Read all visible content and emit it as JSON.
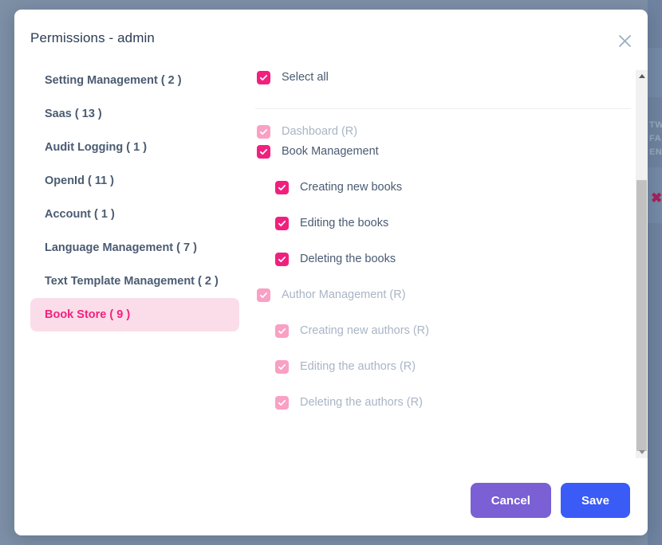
{
  "modal": {
    "title": "Permissions - admin",
    "close_icon": "close-icon"
  },
  "groups": [
    {
      "label": "Setting Management ( 2 )",
      "active": false
    },
    {
      "label": "Saas ( 13 )",
      "active": false
    },
    {
      "label": "Audit Logging ( 1 )",
      "active": false
    },
    {
      "label": "OpenId ( 11 )",
      "active": false
    },
    {
      "label": "Account ( 1 )",
      "active": false
    },
    {
      "label": "Language Management ( 7 )",
      "active": false
    },
    {
      "label": "Text Template Management ( 2 )",
      "active": false
    },
    {
      "label": "Book Store ( 9 )",
      "active": true
    }
  ],
  "select_all": {
    "label": "Select all",
    "checked": true,
    "disabled": false
  },
  "permissions": [
    {
      "label": "Dashboard (R)",
      "level": 0,
      "checked": true,
      "disabled": true,
      "spacing": "none"
    },
    {
      "label": "Book Management",
      "level": 0,
      "checked": true,
      "disabled": false,
      "spacing": "tight"
    },
    {
      "label": "Creating new books",
      "level": 1,
      "checked": true,
      "disabled": false,
      "spacing": "gap"
    },
    {
      "label": "Editing the books",
      "level": 1,
      "checked": true,
      "disabled": false,
      "spacing": "gap"
    },
    {
      "label": "Deleting the books",
      "level": 1,
      "checked": true,
      "disabled": false,
      "spacing": "gap"
    },
    {
      "label": "Author Management (R)",
      "level": 0,
      "checked": true,
      "disabled": true,
      "spacing": "gap"
    },
    {
      "label": "Creating new authors (R)",
      "level": 1,
      "checked": true,
      "disabled": true,
      "spacing": "gap"
    },
    {
      "label": "Editing the authors (R)",
      "level": 1,
      "checked": true,
      "disabled": true,
      "spacing": "gap"
    },
    {
      "label": "Deleting the authors (R)",
      "level": 1,
      "checked": true,
      "disabled": true,
      "spacing": "gap"
    }
  ],
  "scrollbar": {
    "up_arrow_icon": "chevron-up-icon",
    "down_arrow_icon": "chevron-down-icon"
  },
  "footer": {
    "cancel_label": "Cancel",
    "save_label": "Save"
  },
  "background": {
    "text_lines": [
      "TW",
      "FA",
      "EN"
    ],
    "close_icon": "remove-icon"
  },
  "colors": {
    "accent_pink": "#f1207e",
    "accent_pink_disabled": "#f9a0c4",
    "active_item_bg": "#fbdde9",
    "cancel_purple": "#7b5fd4",
    "save_blue": "#3a5bf5",
    "backdrop": "#7d8fa6",
    "text_primary": "#4a5b72",
    "text_dim": "#a9b5c5"
  }
}
